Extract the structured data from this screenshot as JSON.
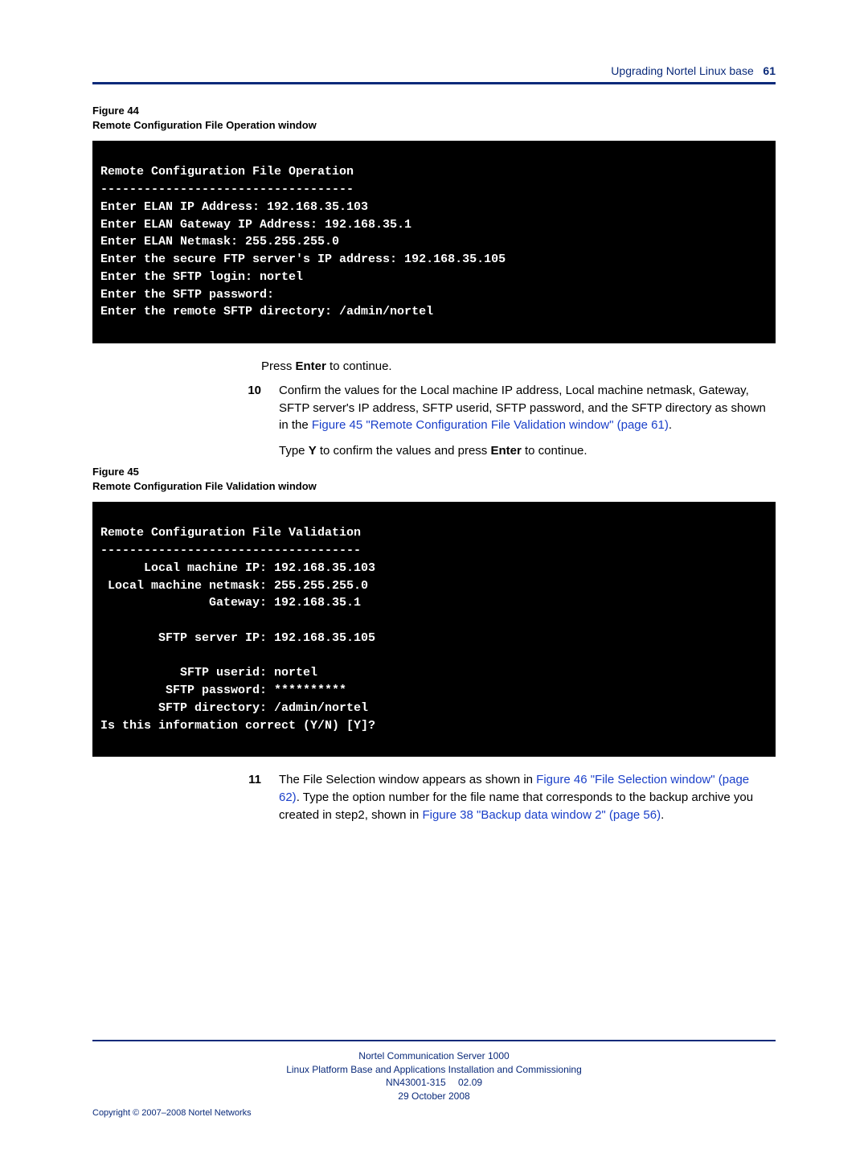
{
  "header": {
    "title": "Upgrading Nortel Linux base",
    "page_number": "61"
  },
  "figure44": {
    "label": "Figure 44",
    "title": "Remote Configuration File Operation window",
    "terminal": "Remote Configuration File Operation\n-----------------------------------\nEnter ELAN IP Address: 192.168.35.103\nEnter ELAN Gateway IP Address: 192.168.35.1\nEnter ELAN Netmask: 255.255.255.0\nEnter the secure FTP server's IP address: 192.168.35.105\nEnter the SFTP login: nortel\nEnter the SFTP password:\nEnter the remote SFTP directory: /admin/nortel"
  },
  "press_enter": {
    "pre": "Press ",
    "key": "Enter",
    "post": " to continue."
  },
  "step10": {
    "num": "10",
    "text1": "Confirm the values for the Local machine IP address, Local machine netmask, Gateway, SFTP server's IP address, SFTP userid, SFTP password, and the SFTP directory as shown in the ",
    "link1": "Figure 45 \"Remote Configuration File Validation window\" (page 61)",
    "text2": ".",
    "text3_pre": "Type ",
    "text3_key1": "Y",
    "text3_mid": " to confirm the values and press ",
    "text3_key2": "Enter",
    "text3_post": " to continue."
  },
  "figure45": {
    "label": "Figure 45",
    "title": "Remote Configuration File Validation window",
    "terminal": "Remote Configuration File Validation\n------------------------------------\n      Local machine IP: 192.168.35.103\n Local machine netmask: 255.255.255.0\n               Gateway: 192.168.35.1\n\n        SFTP server IP: 192.168.35.105\n\n           SFTP userid: nortel\n         SFTP password: **********\n        SFTP directory: /admin/nortel\nIs this information correct (Y/N) [Y]?"
  },
  "step11": {
    "num": "11",
    "text1": "The File Selection window appears as shown in ",
    "link1": "Figure 46 \"File Selection window\" (page 62)",
    "text2": ". Type the option number for the file name that corresponds to the backup archive you created in step2, shown in ",
    "link2": "Figure 38 \"Backup data window 2\" (page 56)",
    "text3": "."
  },
  "footer": {
    "line1": "Nortel Communication Server 1000",
    "line2": "Linux Platform Base and Applications Installation and Commissioning",
    "line3": "NN43001-315  02.09",
    "line4": "29 October 2008",
    "copyright": "Copyright © 2007–2008 Nortel Networks"
  }
}
